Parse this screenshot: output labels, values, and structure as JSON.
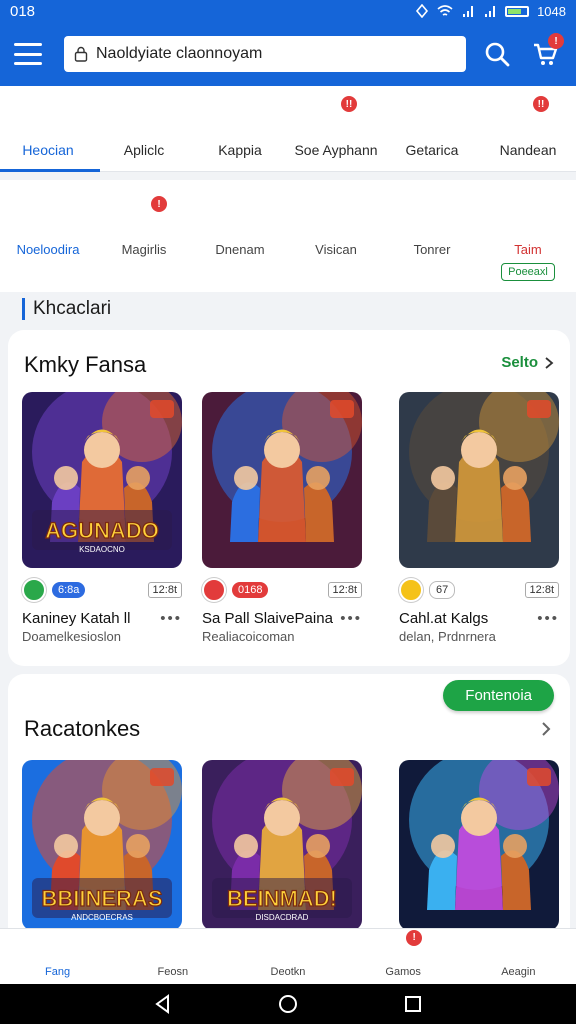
{
  "status_bar": {
    "time": "018",
    "clock": "1048"
  },
  "search": {
    "value": "Naoldyiate claonnoyam"
  },
  "header": {
    "cart_badge": "!"
  },
  "categories": [
    {
      "label": "Heocian",
      "icon": "game-pad-icon",
      "active": true
    },
    {
      "label": "Apliclc",
      "icon": "tools-icon"
    },
    {
      "label": "Kappia",
      "icon": "text-ai-icon"
    },
    {
      "label": "Soe Ayphann",
      "icon": "chat-icon",
      "badge": "!!"
    },
    {
      "label": "Getarica",
      "icon": "games-grid-icon"
    },
    {
      "label": "Nandean",
      "icon": "user-icon",
      "badge": "!!"
    }
  ],
  "sub_items": [
    {
      "label": "Noeloodira",
      "icon": "list-icon",
      "active": true
    },
    {
      "label": "Magirlis",
      "icon": "message-icon",
      "badge": "!"
    },
    {
      "label": "Dnenam",
      "icon": "tablet-icon"
    },
    {
      "label": "Visican",
      "icon": "target-icon"
    },
    {
      "label": "Tonrer",
      "icon": "mail-icon"
    },
    {
      "label": "Taim",
      "icon": "more-dots-icon",
      "chip": "Poeeaxl"
    }
  ],
  "section_heading": "Khcaclari",
  "featured": {
    "title": "Kmky Fansa",
    "see_label": "Selto",
    "apps": [
      {
        "art_text": "AGUNADO",
        "art_sub": "KSDAOCNO",
        "pill": "6:8a",
        "pill_color": "#2d6be0",
        "dot_color": "#2aa84a",
        "size": "12:8t",
        "name": "Kaniney Katah",
        "name_suffix": "ll",
        "sub": "Doamelkesioslon",
        "palette": [
          "#2a1b5c",
          "#f0712c",
          "#6b3fc2"
        ]
      },
      {
        "art_text": "",
        "art_sub": "",
        "pill": "0168",
        "pill_color": "#e23b3b",
        "dot_color": "#e23b3b",
        "size": "12:8t",
        "name": "Sa Pall SlaivePaina",
        "name_suffix": "",
        "sub": "Realiacoicoman",
        "palette": [
          "#4b1b3a",
          "#e05b2c",
          "#2c6ee0"
        ]
      },
      {
        "art_text": "",
        "art_sub": "",
        "pill": "67",
        "pill_color": "#ffffff",
        "dot_color": "#f5c218",
        "size": "12:8t",
        "name": "Cahl.at Kalgs",
        "name_suffix": "",
        "sub": "delan, Prdnrnera",
        "palette": [
          "#2f3a4a",
          "#d59a3a",
          "#5a4a3a"
        ]
      }
    ]
  },
  "recommended": {
    "title": "Racatonkes",
    "button_label": "Fontenoia",
    "apps": [
      {
        "art_text": "BBIINERAS",
        "art_sub": "ANDCBOECRAS",
        "palette": [
          "#1b6ee0",
          "#f29a28",
          "#e04a2c"
        ]
      },
      {
        "art_text": "BEINMAD!",
        "art_sub": "DISDACDRAD",
        "palette": [
          "#3a1f5c",
          "#f0b33a",
          "#7a2ca8"
        ]
      },
      {
        "art_text": "",
        "art_sub": "",
        "palette": [
          "#101a3a",
          "#c94ae0",
          "#3ab0f0"
        ]
      }
    ]
  },
  "bottom_nav": [
    {
      "label": "Fang",
      "icon": "home-icon",
      "active": true
    },
    {
      "label": "Feosn",
      "icon": "window-icon"
    },
    {
      "label": "Deotkn",
      "icon": "building-icon"
    },
    {
      "label": "Gamos",
      "icon": "chat-bubble-icon",
      "badge": "!"
    },
    {
      "label": "Aeagin",
      "icon": "profile-icon"
    }
  ],
  "colors": {
    "primary": "#1565d8",
    "accent_green": "#1ea446",
    "badge_red": "#e23b3b"
  }
}
